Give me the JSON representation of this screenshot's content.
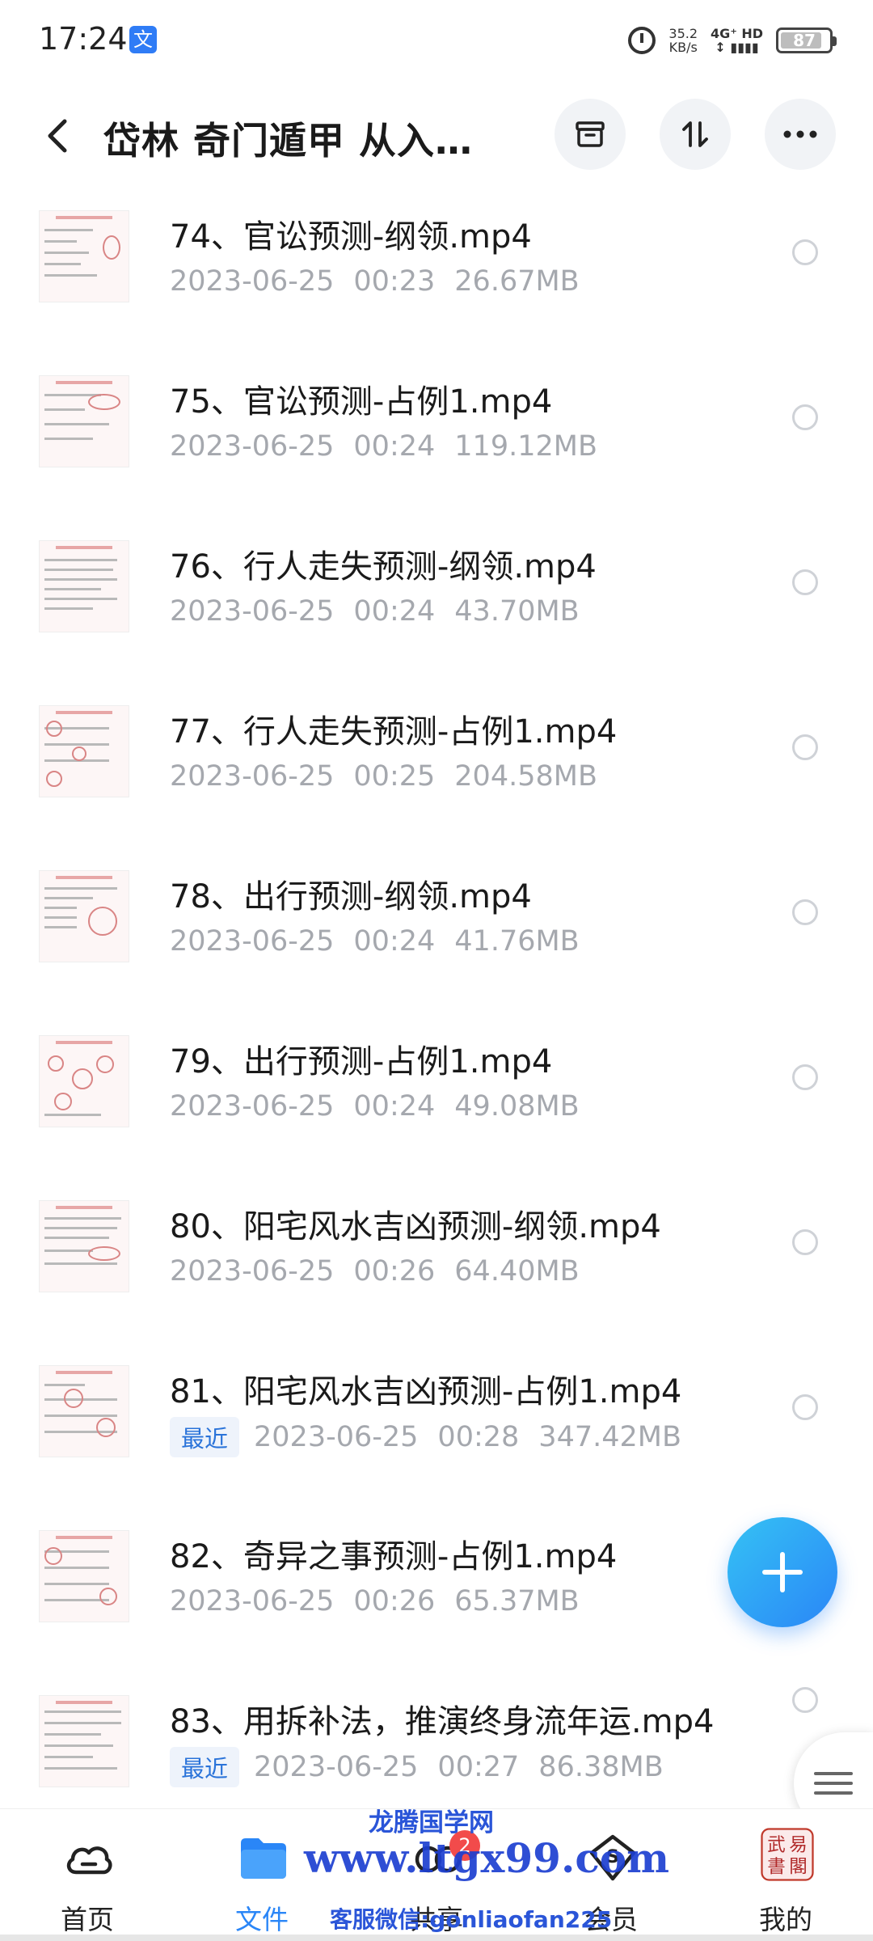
{
  "status_bar": {
    "time": "17:24",
    "app_icon_glyph": "文",
    "net_speed_value": "35.2",
    "net_speed_unit": "KB/s",
    "signal_top": "4G⁺ HD",
    "signal_bottom": "↕ ▮▮▮▮",
    "battery": "87",
    "battery_level": 0.87
  },
  "header": {
    "title": "岱林 奇门遁甲 从入…",
    "back_icon": "chevron-left-icon",
    "actions": [
      "archive-icon",
      "sort-icon",
      "more-icon"
    ]
  },
  "files": [
    {
      "name": "74、官讼预测-纲领.mp4",
      "date": "2023-06-25",
      "time": "00:23",
      "size": "26.67MB",
      "badge": null
    },
    {
      "name": "75、官讼预测-占例1.mp4",
      "date": "2023-06-25",
      "time": "00:24",
      "size": "119.12MB",
      "badge": null
    },
    {
      "name": "76、行人走失预测-纲领.mp4",
      "date": "2023-06-25",
      "time": "00:24",
      "size": "43.70MB",
      "badge": null
    },
    {
      "name": "77、行人走失预测-占例1.mp4",
      "date": "2023-06-25",
      "time": "00:25",
      "size": "204.58MB",
      "badge": null
    },
    {
      "name": "78、出行预测-纲领.mp4",
      "date": "2023-06-25",
      "time": "00:24",
      "size": "41.76MB",
      "badge": null
    },
    {
      "name": "79、出行预测-占例1.mp4",
      "date": "2023-06-25",
      "time": "00:24",
      "size": "49.08MB",
      "badge": null
    },
    {
      "name": "80、阳宅风水吉凶预测-纲领.mp4",
      "date": "2023-06-25",
      "time": "00:26",
      "size": "64.40MB",
      "badge": null
    },
    {
      "name": "81、阳宅风水吉凶预测-占例1.mp4",
      "date": "2023-06-25",
      "time": "00:28",
      "size": "347.42MB",
      "badge": "最近"
    },
    {
      "name": "82、奇异之事预测-占例1.mp4",
      "date": "2023-06-25",
      "time": "00:26",
      "size": "65.37MB",
      "badge": null
    },
    {
      "name": "83、用拆补法，推演终身流年运.mp4",
      "date": "2023-06-25",
      "time": "00:27",
      "size": "86.38MB",
      "badge": "最近"
    }
  ],
  "fab": {
    "icon": "plus-icon"
  },
  "side_handle": {
    "icon": "menu-icon"
  },
  "bottom_nav": [
    {
      "label": "首页",
      "icon": "cloud-icon",
      "active": false,
      "badge": null
    },
    {
      "label": "文件",
      "icon": "folder-icon",
      "active": true,
      "badge": null
    },
    {
      "label": "共享",
      "icon": "share-icon",
      "active": false,
      "badge": "2"
    },
    {
      "label": "会员",
      "icon": "vip-icon",
      "active": false,
      "badge": null
    },
    {
      "label": "我的",
      "icon": "avatar-icon",
      "active": false,
      "badge": null
    }
  ],
  "avatar_seal": [
    "武",
    "易",
    "書",
    "閣"
  ],
  "watermark": {
    "line1": "龙腾国学网",
    "line2": "www.ltgx99.com",
    "line3": "客服微信:gonliaofan225"
  },
  "colors": {
    "accent": "#2a86f7",
    "badge_red": "#f24b4b",
    "meta_gray": "#a5a8ae",
    "recent_badge_bg": "#eef3fb",
    "recent_badge_text": "#2a73d9"
  }
}
